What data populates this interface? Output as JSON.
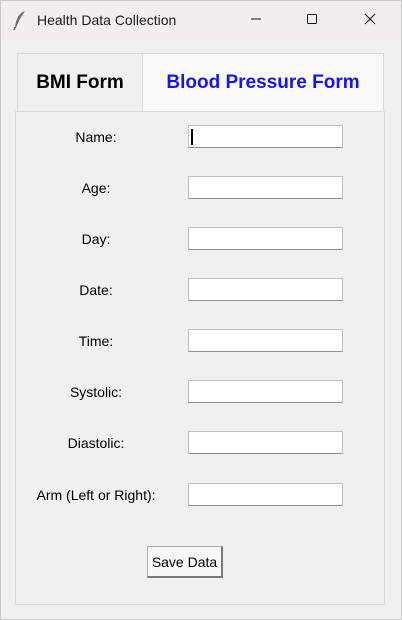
{
  "window": {
    "title": "Health Data Collection"
  },
  "tabs": [
    {
      "label": "BMI Form",
      "active": false
    },
    {
      "label": "Blood Pressure Form",
      "active": true,
      "color": "#1515e6"
    }
  ],
  "form": {
    "fields": [
      {
        "label": "Name:",
        "value": ""
      },
      {
        "label": "Age:",
        "value": ""
      },
      {
        "label": "Day:",
        "value": ""
      },
      {
        "label": "Date:",
        "value": ""
      },
      {
        "label": "Time:",
        "value": ""
      },
      {
        "label": "Systolic:",
        "value": ""
      },
      {
        "label": "Diastolic:",
        "value": ""
      },
      {
        "label": "Arm (Left or Right):",
        "value": ""
      }
    ],
    "save_label": "Save Data"
  },
  "icons": {
    "app": "feather-pen-icon",
    "minimize": "minimize-icon",
    "maximize": "maximize-icon",
    "close": "close-icon"
  }
}
